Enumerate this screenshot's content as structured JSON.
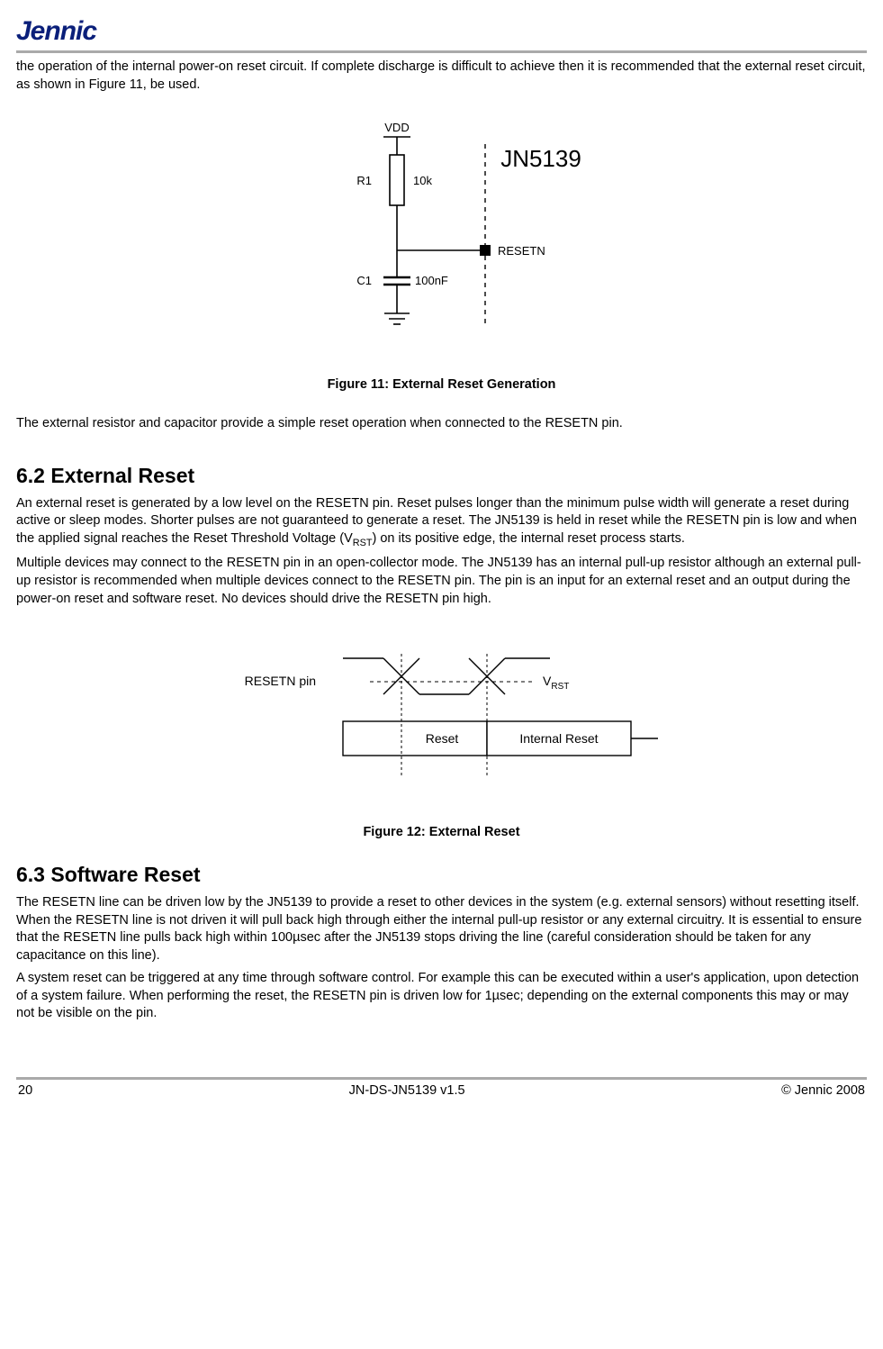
{
  "header": {
    "logo": "Jennic"
  },
  "intro_para": "the operation of the internal power-on reset circuit. If complete discharge is difficult to achieve then it is recommended that the external reset circuit, as shown in Figure 11, be used.",
  "figure11": {
    "caption": "Figure 11: External Reset Generation",
    "labels": {
      "vdd": "VDD",
      "r1": "R1",
      "r1_val": "10k",
      "c1": "C1",
      "c1_val": "100nF",
      "chip": "JN5139",
      "pin": "RESETN"
    }
  },
  "after_fig11": "The external resistor and capacitor provide a simple reset operation when connected to the RESETN pin.",
  "section62": {
    "title": "6.2  External Reset",
    "p1": "An external reset is generated by a low level on the RESETN pin.  Reset pulses longer than the minimum pulse width will generate a reset during active or sleep modes.  Shorter pulses are not guaranteed to generate a reset.  The JN5139 is held in reset while the RESETN pin is low and when the applied signal reaches the Reset Threshold Voltage (V",
    "p1_sub": "RST",
    "p1_tail": ") on its positive edge, the internal reset process starts.",
    "p2": "Multiple devices may connect to the RESETN pin in an open-collector mode.  The JN5139 has an internal pull-up resistor although an external pull-up resistor is recommended when multiple devices connect to the RESETN pin.  The pin is an input for an external reset and an output during the power-on reset and software reset.  No devices should drive the RESETN pin high."
  },
  "figure12": {
    "caption": "Figure 12: External Reset",
    "labels": {
      "pin": "RESETN pin",
      "vrst_v": "V",
      "vrst_sub": "RST",
      "reset": "Reset",
      "internal": "Internal Reset"
    }
  },
  "section63": {
    "title": "6.3  Software Reset",
    "p1": "The RESETN line can be driven low by the JN5139 to provide a reset to other devices in the system (e.g. external sensors) without resetting itself. When the RESETN line is not driven it will pull back high through either the internal pull-up resistor or any external circuitry. It is essential to ensure that the RESETN line pulls back high within 100µsec after the JN5139 stops driving the line (careful consideration should be taken for any capacitance on this line).",
    "p2": "A system reset can be triggered at any time through software control. For example this can be executed within a user's application, upon detection of a system failure. When performing the reset, the RESETN pin is driven low for 1µsec; depending on the external components this may or may not be visible on the pin."
  },
  "footer": {
    "page": "20",
    "docid": "JN-DS-JN5139 v1.5",
    "copyright": "© Jennic 2008"
  }
}
